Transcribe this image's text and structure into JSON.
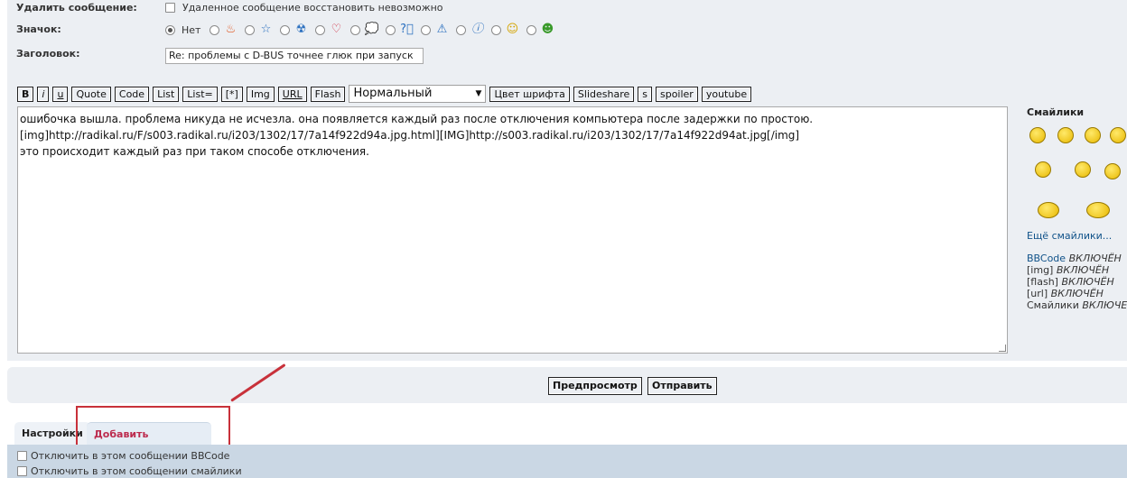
{
  "form": {
    "delete_label": "Удалить сообщение:",
    "delete_text": "Удаленное сообщение восстановить невозможно",
    "icon_label": "Значок:",
    "icon_none": "Нет",
    "icons": [
      "fire-icon",
      "star-icon",
      "radioactive-icon",
      "heart-icon",
      "speech-bubble-icon",
      "question-icon",
      "warning-icon",
      "info-icon",
      "smiley-wink-icon",
      "smiley-grin-icon"
    ],
    "subject_label": "Заголовок:",
    "subject_value": "Re: проблемы с D-BUS точнее глюк при запуск"
  },
  "toolbar": {
    "buttons": [
      "B",
      "i",
      "u",
      "Quote",
      "Code",
      "List",
      "List=",
      "[*]",
      "Img",
      "URL",
      "Flash"
    ],
    "font_size": "Нормальный",
    "buttons2": [
      "Цвет шрифта",
      "Slideshare",
      "s",
      "spoiler",
      "youtube"
    ]
  },
  "editor": {
    "lines": [
      "ошибочка вышла. проблема никуда не исчезла. она появляется каждый раз после отключения компьютера после задержки по простою.",
      "[img]http://radikal.ru/F/s003.radikal.ru/i203/1302/17/7a14f922d94a.jpg.html][IMG]http://s003.radikal.ru/i203/1302/17/7a14f922d94at.jpg[/img]",
      "это происходит каждый раз при таком способе отключения."
    ]
  },
  "sidebar": {
    "title": "Смайлики",
    "more": "Ещё смайлики...",
    "status": [
      {
        "name": "BBCode",
        "state": "ВКЛЮЧЁН"
      },
      {
        "name": "[img]",
        "state": "ВКЛЮЧЁН"
      },
      {
        "name": "[flash]",
        "state": "ВКЛЮЧЁН"
      },
      {
        "name": "[url]",
        "state": "ВКЛЮЧЁН"
      },
      {
        "name": "Смайлики",
        "state": "ВКЛЮЧЕ"
      }
    ]
  },
  "actions": {
    "preview": "Предпросмотр",
    "submit": "Отправить"
  },
  "tabs": {
    "settings": "Настройки",
    "attach": "Добавить вложения"
  },
  "options": {
    "disable_bbcode": "Отключить в этом сообщении BBCode",
    "disable_smilies": "Отключить в этом сообщении смайлики"
  },
  "colors": {
    "accent_link": "#105289",
    "annotation_red": "#c8313a",
    "panel": "#eceff3"
  }
}
